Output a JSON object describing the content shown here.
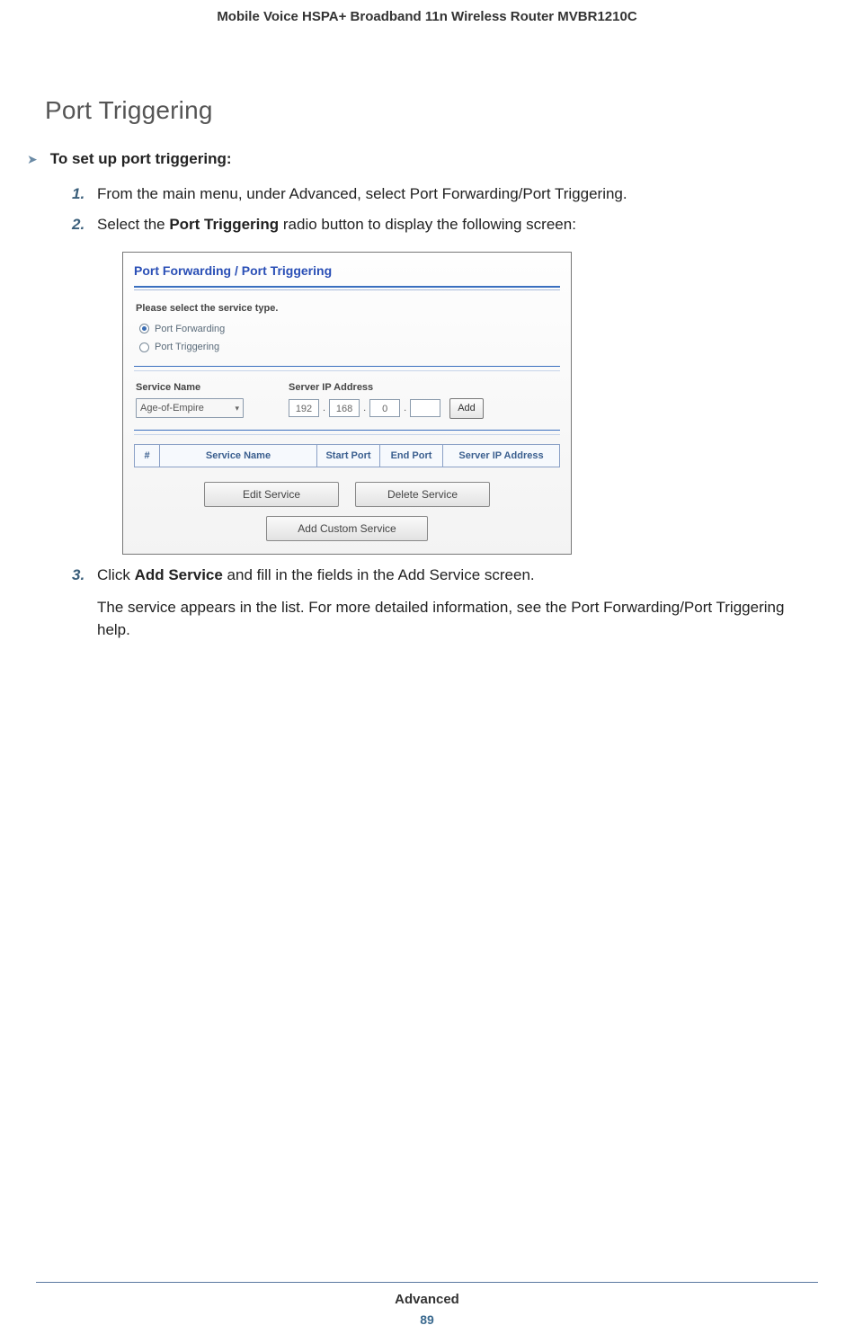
{
  "header": {
    "title": "Mobile Voice HSPA+ Broadband 11n Wireless Router MVBR1210C"
  },
  "section": {
    "title": "Port Triggering"
  },
  "task": {
    "arrow": "➤",
    "text": "To set up port triggering:"
  },
  "steps": {
    "s1": {
      "num": "1.",
      "text": "From the main menu, under Advanced, select Port Forwarding/Port Triggering."
    },
    "s2": {
      "num": "2.",
      "prefix": "Select the ",
      "bold": "Port Triggering",
      "suffix": " radio button to display the following screen:"
    },
    "s3": {
      "num": "3.",
      "prefix": "Click ",
      "bold": "Add Service",
      "suffix": " and fill in the fields in the Add Service screen.",
      "after": "The service appears in the list. For more detailed information, see the Port Forwarding/Port Triggering help."
    }
  },
  "screenshot": {
    "title": "Port Forwarding / Port Triggering",
    "prompt": "Please select the service type.",
    "radio1": "Port Forwarding",
    "radio2": "Port Triggering",
    "label_service": "Service Name",
    "label_ip": "Server IP Address",
    "select_value": "Age-of-Empire",
    "ip1": "192",
    "ip2": "168",
    "ip3": "0",
    "ip4": "",
    "btn_add": "Add",
    "th_hash": "#",
    "th_service": "Service Name",
    "th_start": "Start Port",
    "th_end": "End Port",
    "th_server": "Server IP Address",
    "btn_edit": "Edit Service",
    "btn_delete": "Delete Service",
    "btn_custom": "Add Custom Service"
  },
  "footer": {
    "label": "Advanced",
    "page": "89"
  }
}
